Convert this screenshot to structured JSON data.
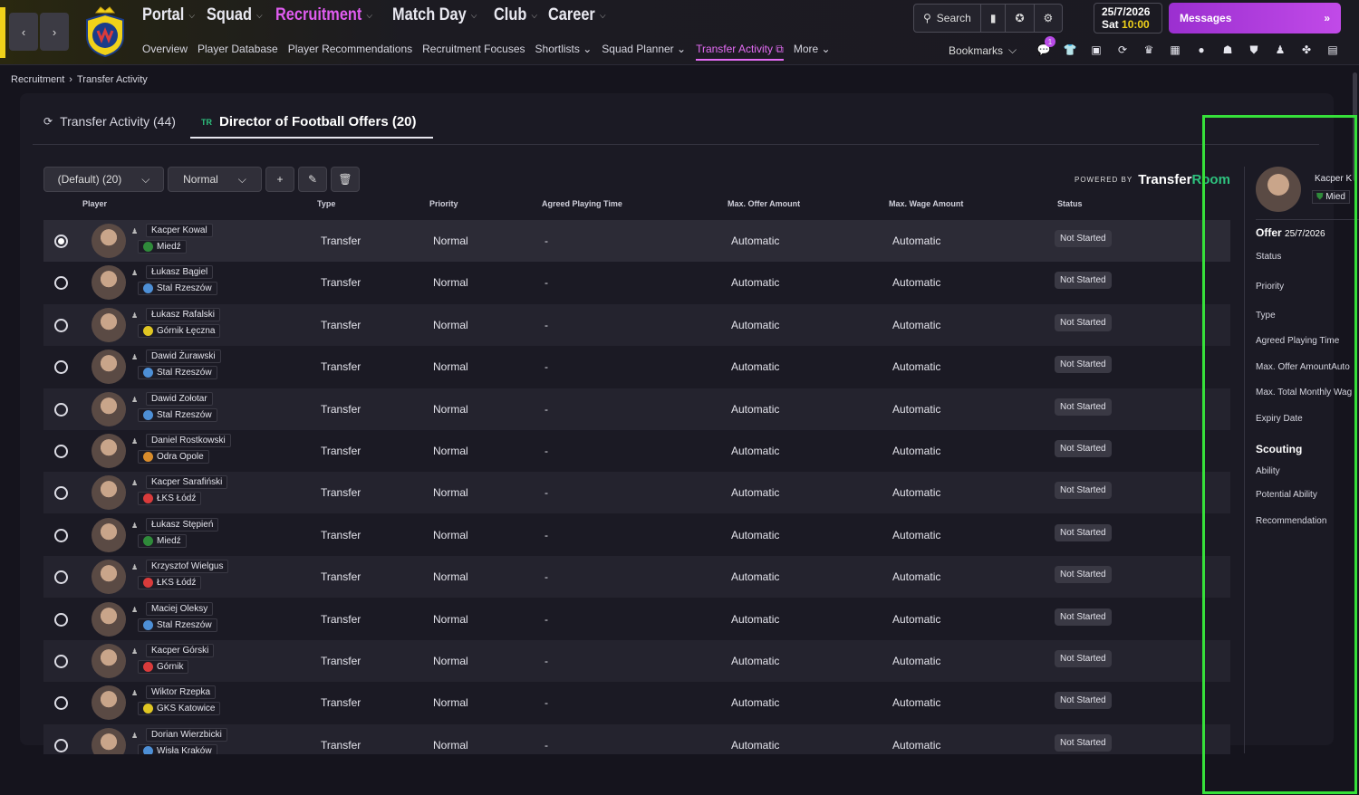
{
  "nav": {
    "main": [
      {
        "label": "Portal",
        "chevron": true
      },
      {
        "label": "Squad",
        "chevron": true
      },
      {
        "label": "Recruitment",
        "chevron": true,
        "active": true
      },
      {
        "label": "Match Day",
        "chevron": true
      },
      {
        "label": "Club",
        "chevron": true
      },
      {
        "label": "Career",
        "chevron": true
      }
    ],
    "sub": [
      "Overview",
      "Player Database",
      "Player Recommendations",
      "Recruitment Focuses",
      "Shortlists ⌄",
      "Squad Planner ⌄",
      "Transfer Activity ⧉",
      "More ⌄"
    ],
    "sub_active_index": 6
  },
  "toolbar": {
    "search_label": "Search"
  },
  "date": {
    "date": "25/7/2026",
    "day": "Sat",
    "time": "10:00"
  },
  "messages": {
    "label": "Messages"
  },
  "bookmarks": {
    "label": "Bookmarks",
    "badge": "1"
  },
  "breadcrumb": {
    "parent": "Recruitment",
    "current": "Transfer Activity"
  },
  "tabs": [
    {
      "label": "Transfer Activity (44)"
    },
    {
      "label": "Director of Football Offers (20)",
      "prefix": "TR",
      "active": true
    }
  ],
  "controls": {
    "view": "(Default) (20)",
    "filter": "Normal"
  },
  "powered": {
    "by": "POWERED BY",
    "brand_a": "Transfer",
    "brand_b": "Room"
  },
  "columns": {
    "player": "Player",
    "type": "Type",
    "priority": "Priority",
    "apt": "Agreed Playing Time",
    "max_offer": "Max. Offer Amount",
    "max_wage": "Max. Wage Amount",
    "status": "Status"
  },
  "rows": [
    {
      "name": "Kacper Kowal",
      "club": "Miedź",
      "club_color": "#2f8a3a",
      "type": "Transfer",
      "priority": "Normal",
      "apt": "-",
      "max_offer": "Automatic",
      "max_wage": "Automatic",
      "status": "Not Started",
      "selected": true
    },
    {
      "name": "Łukasz Bągiel",
      "club": "Stal Rzeszów",
      "club_color": "#4d8fd6",
      "type": "Transfer",
      "priority": "Normal",
      "apt": "-",
      "max_offer": "Automatic",
      "max_wage": "Automatic",
      "status": "Not Started"
    },
    {
      "name": "Łukasz Rafalski",
      "club": "Górnik Łęczna",
      "club_color": "#e0c623",
      "type": "Transfer",
      "priority": "Normal",
      "apt": "-",
      "max_offer": "Automatic",
      "max_wage": "Automatic",
      "status": "Not Started"
    },
    {
      "name": "Dawid Żurawski",
      "club": "Stal Rzeszów",
      "club_color": "#4d8fd6",
      "type": "Transfer",
      "priority": "Normal",
      "apt": "-",
      "max_offer": "Automatic",
      "max_wage": "Automatic",
      "status": "Not Started"
    },
    {
      "name": "Dawid Zołotar",
      "club": "Stal Rzeszów",
      "club_color": "#4d8fd6",
      "type": "Transfer",
      "priority": "Normal",
      "apt": "-",
      "max_offer": "Automatic",
      "max_wage": "Automatic",
      "status": "Not Started"
    },
    {
      "name": "Daniel Rostkowski",
      "club": "Odra Opole",
      "club_color": "#d98c2b",
      "type": "Transfer",
      "priority": "Normal",
      "apt": "-",
      "max_offer": "Automatic",
      "max_wage": "Automatic",
      "status": "Not Started"
    },
    {
      "name": "Kacper Sarafiński",
      "club": "ŁKS Łódź",
      "club_color": "#d93b3b",
      "type": "Transfer",
      "priority": "Normal",
      "apt": "-",
      "max_offer": "Automatic",
      "max_wage": "Automatic",
      "status": "Not Started"
    },
    {
      "name": "Łukasz Stępień",
      "club": "Miedź",
      "club_color": "#2f8a3a",
      "type": "Transfer",
      "priority": "Normal",
      "apt": "-",
      "max_offer": "Automatic",
      "max_wage": "Automatic",
      "status": "Not Started"
    },
    {
      "name": "Krzysztof Wielgus",
      "club": "ŁKS Łódź",
      "club_color": "#d93b3b",
      "type": "Transfer",
      "priority": "Normal",
      "apt": "-",
      "max_offer": "Automatic",
      "max_wage": "Automatic",
      "status": "Not Started"
    },
    {
      "name": "Maciej Oleksy",
      "club": "Stal Rzeszów",
      "club_color": "#4d8fd6",
      "type": "Transfer",
      "priority": "Normal",
      "apt": "-",
      "max_offer": "Automatic",
      "max_wage": "Automatic",
      "status": "Not Started"
    },
    {
      "name": "Kacper Górski",
      "club": "Górnik",
      "club_color": "#d93b3b",
      "type": "Transfer",
      "priority": "Normal",
      "apt": "-",
      "max_offer": "Automatic",
      "max_wage": "Automatic",
      "status": "Not Started"
    },
    {
      "name": "Wiktor Rzepka",
      "club": "GKS Katowice",
      "club_color": "#e0c623",
      "type": "Transfer",
      "priority": "Normal",
      "apt": "-",
      "max_offer": "Automatic",
      "max_wage": "Automatic",
      "status": "Not Started"
    },
    {
      "name": "Dorian Wierzbicki",
      "club": "Wisła Kraków",
      "club_color": "#4d8fd6",
      "type": "Transfer",
      "priority": "Normal",
      "apt": "-",
      "max_offer": "Automatic",
      "max_wage": "Automatic",
      "status": "Not Started"
    }
  ],
  "side": {
    "name": "Kacper K",
    "club": "Mied",
    "offer_title": "Offer",
    "offer_date": "25/7/2026",
    "labels": [
      "Status",
      "Priority",
      "Type",
      "Agreed Playing Time",
      "Max. Offer Amount",
      "Max. Total Monthly Wag",
      "Expiry Date"
    ],
    "max_offer_value": "Auto",
    "scouting_title": "Scouting",
    "scouting_labels": [
      "Ability",
      "Potential Ability",
      "Recommendation"
    ]
  },
  "colors": {
    "accent": "#e05cf0",
    "highlight": "#36e03a",
    "brand_green": "#2ec27e"
  }
}
